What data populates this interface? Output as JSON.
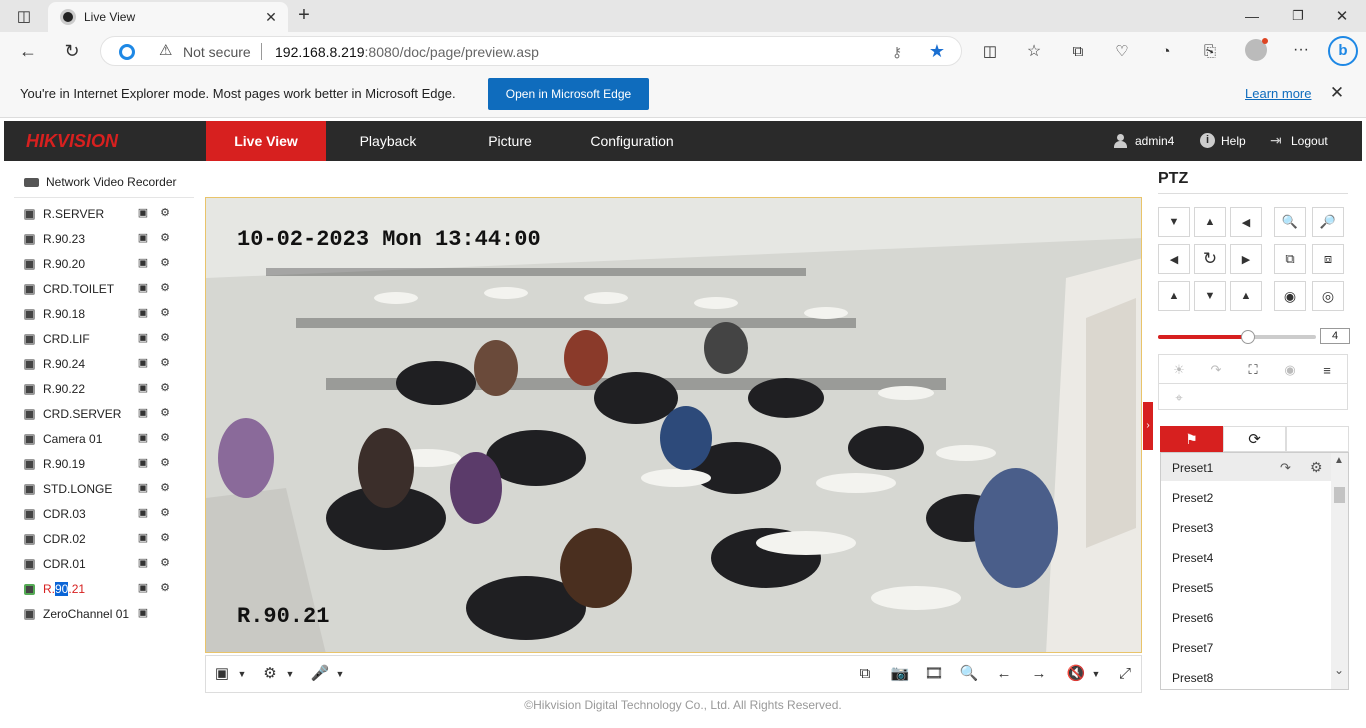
{
  "browser": {
    "tab_title": "Live View",
    "not_secure": "Not secure",
    "url_host": "192.168.8.219",
    "url_rest": ":8080/doc/page/preview.asp",
    "ie_message": "You're in Internet Explorer mode. Most pages work better in Microsoft Edge.",
    "ie_open_button": "Open in Microsoft Edge",
    "ie_learn_more": "Learn more"
  },
  "nav": {
    "logo": "HIKVISION",
    "items": [
      "Live View",
      "Playback",
      "Picture",
      "Configuration"
    ],
    "active": "Live View",
    "user": "admin4",
    "help": "Help",
    "logout": "Logout"
  },
  "tree": {
    "root": "Network Video Recorder",
    "cameras": [
      "R.SERVER",
      "R.90.23",
      "R.90.20",
      "CRD.TOILET",
      "R.90.18",
      "CRD.LIF",
      "R.90.24",
      "R.90.22",
      "CRD.SERVER",
      "Camera 01",
      "R.90.19",
      "STD.LONGE",
      "CDR.03",
      "CDR.02",
      "CDR.01"
    ],
    "active_camera": {
      "pre": "R.",
      "highlight": "90",
      "post": ".21"
    },
    "zero_channel": "ZeroChannel 01"
  },
  "video": {
    "timestamp": "10-02-2023 Mon 13:44:00",
    "camera_label": "R.90.21"
  },
  "ptz": {
    "title": "PTZ",
    "speed_value": "4",
    "speed_level": 0.57,
    "presets": [
      "Preset1",
      "Preset2",
      "Preset3",
      "Preset4",
      "Preset5",
      "Preset6",
      "Preset7",
      "Preset8"
    ]
  },
  "footer": "©Hikvision Digital Technology Co., Ltd. All Rights Reserved.",
  "colors": {
    "accent_red": "#d7201f",
    "nav_bg": "#2a2a2a",
    "edge_blue": "#0f6cbd"
  }
}
